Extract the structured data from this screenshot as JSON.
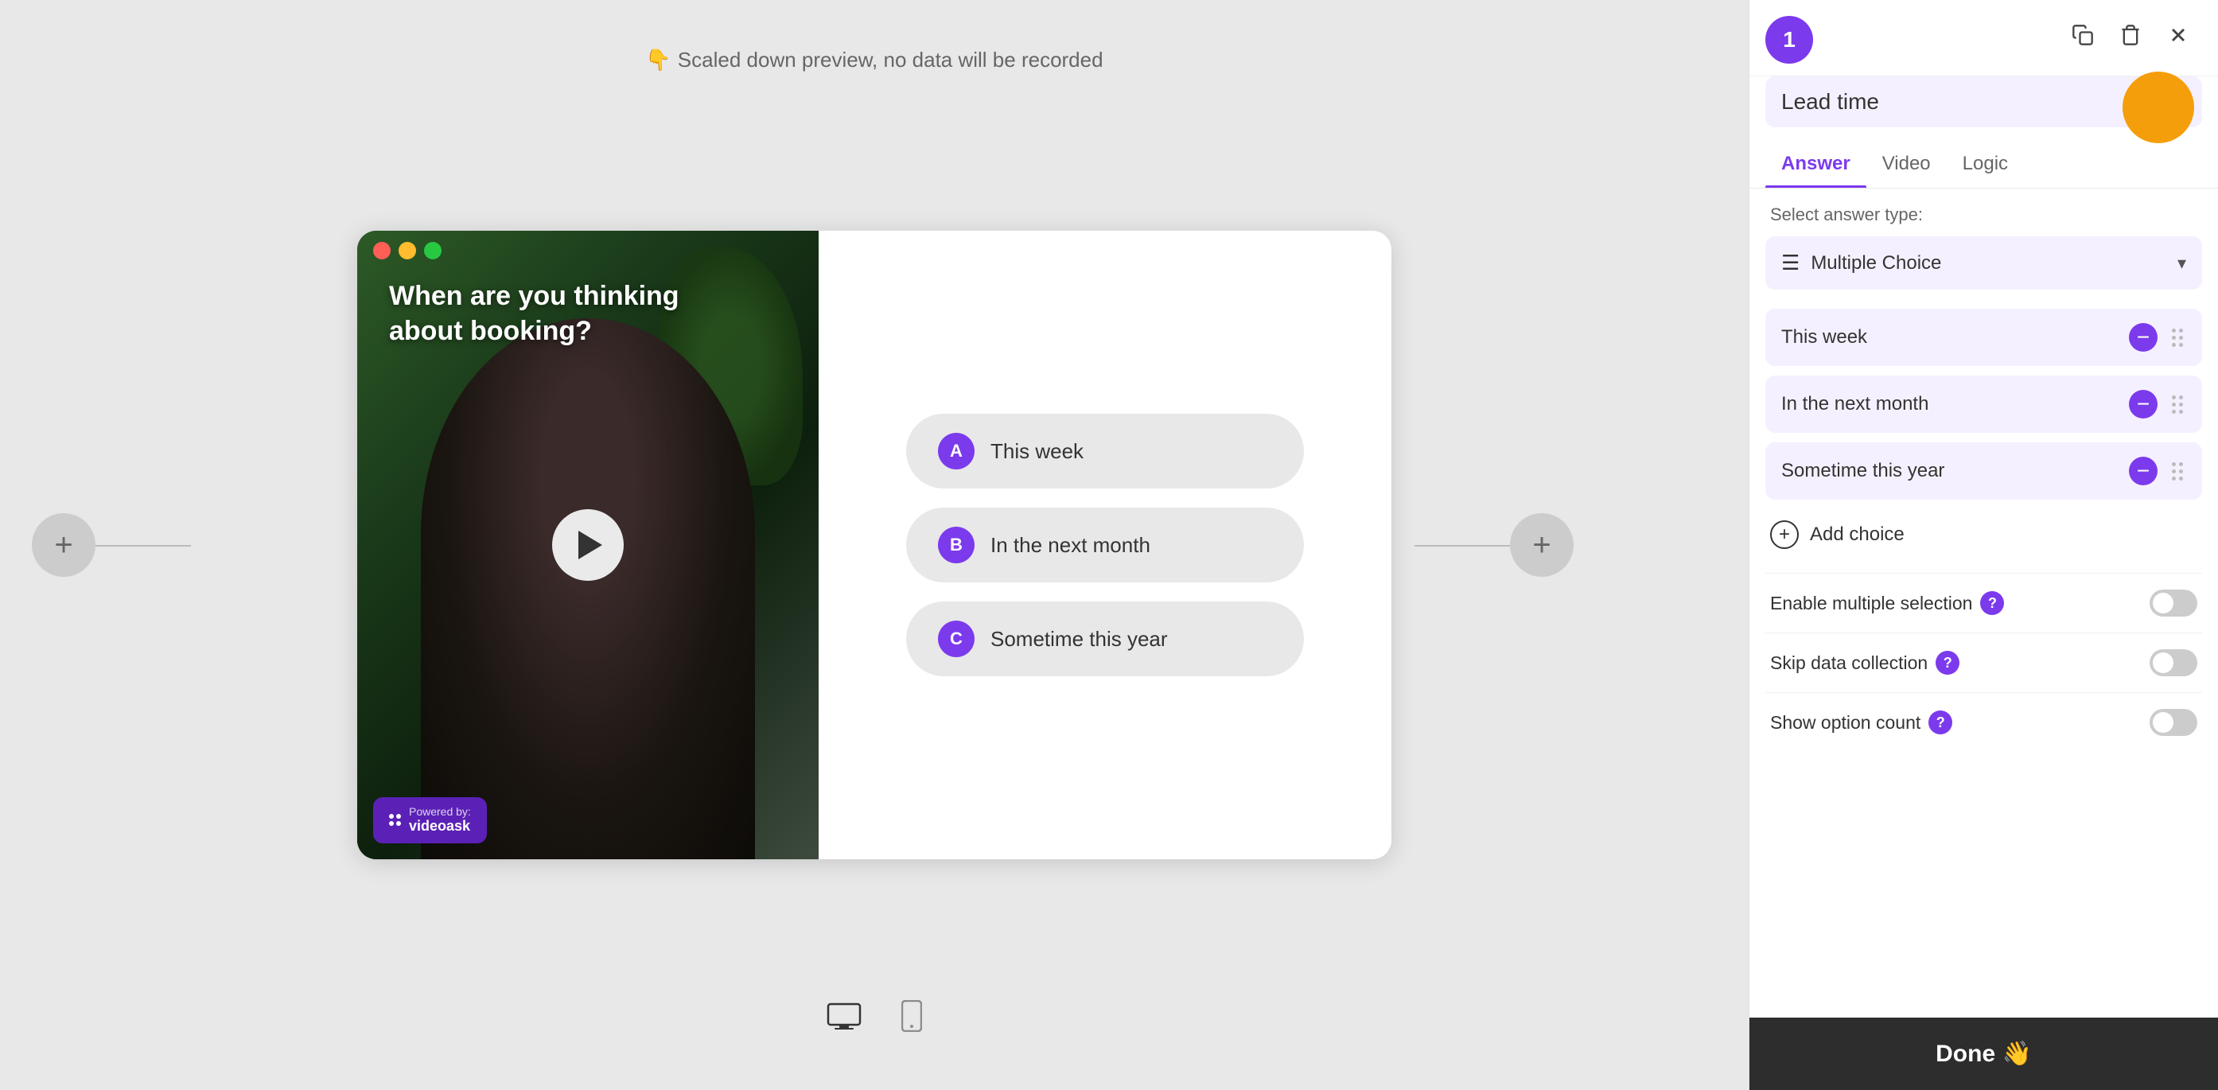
{
  "preview": {
    "notice": "Scaled down preview, no data will be recorded",
    "notice_icon": "👇"
  },
  "video_card": {
    "question_text": "When are you thinking about booking?",
    "choices": [
      {
        "letter": "A",
        "text": "This week"
      },
      {
        "letter": "B",
        "text": "In the next month"
      },
      {
        "letter": "C",
        "text": "Sometime this year"
      }
    ],
    "powered_by_label": "Powered by:",
    "powered_by_brand": "videoask"
  },
  "right_panel": {
    "step_number": "1",
    "question_title": "Lead time",
    "tabs": [
      {
        "label": "Answer",
        "active": true
      },
      {
        "label": "Video",
        "active": false
      },
      {
        "label": "Logic",
        "active": false
      }
    ],
    "answer_type_label": "Select answer type:",
    "answer_type": "Multiple Choice",
    "choices": [
      {
        "text": "This week"
      },
      {
        "text": "In the next month"
      },
      {
        "text": "Sometime this year"
      }
    ],
    "add_choice_label": "Add choice",
    "toggles": [
      {
        "label": "Enable multiple selection",
        "enabled": false
      },
      {
        "label": "Skip data collection",
        "enabled": false
      },
      {
        "label": "Show option count",
        "enabled": false
      }
    ],
    "done_label": "Done 👋",
    "icons": {
      "copy": "⧉",
      "delete": "🗑",
      "close": "✕"
    }
  },
  "device_switcher": {
    "desktop_label": "Desktop",
    "mobile_label": "Mobile"
  }
}
